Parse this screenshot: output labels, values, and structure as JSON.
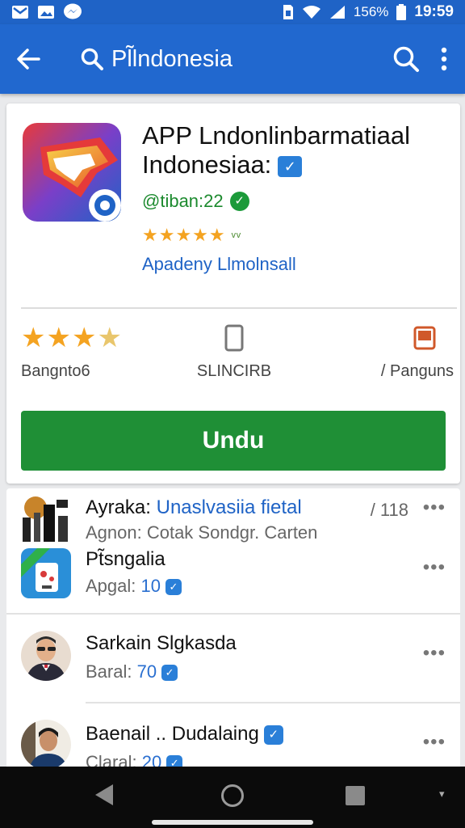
{
  "status_bar": {
    "time": "19:59",
    "battery_text": "156%",
    "icons": [
      "mail-icon",
      "image-icon",
      "messenger-icon",
      "sim-icon",
      "wifi-icon",
      "signal-icon",
      "battery-icon"
    ]
  },
  "app_bar": {
    "search_query": "Pl̃lndonesia"
  },
  "app_detail": {
    "title_line1": "APP Lndonlinbarmatiaal",
    "title_line2": "Indonesiaa:",
    "developer": "@tiban:22",
    "rating_stars": "★★★★★",
    "rating_extra": "ᵛᵛ",
    "link_text": "Apadeny Llmolnsall",
    "stats": [
      {
        "label": "Bangnto6"
      },
      {
        "label": "SLINCIRB"
      },
      {
        "label": "/ Panguns"
      }
    ],
    "install_label": "Undu"
  },
  "list": [
    {
      "title_prefix": "Ayraka:",
      "title_highlight": "Unaslvasiia fietal",
      "count": "/ 118",
      "sub": "Agnon: Cotak Sondgr. Carten"
    },
    {
      "title": "Pt̃sngalia",
      "sub_label": "Apgal:",
      "sub_num": "10"
    },
    {
      "title": "Sarkain Slgkasda",
      "sub_label": "Baral:",
      "sub_num": "70"
    },
    {
      "title": "Baenail .. Dudalaing",
      "sub_label": "Claral:",
      "sub_num": "20"
    }
  ],
  "colors": {
    "primary": "#2168cf",
    "install_green": "#1f8f36",
    "star_orange": "#f4a321",
    "link_blue": "#1f63c6"
  }
}
